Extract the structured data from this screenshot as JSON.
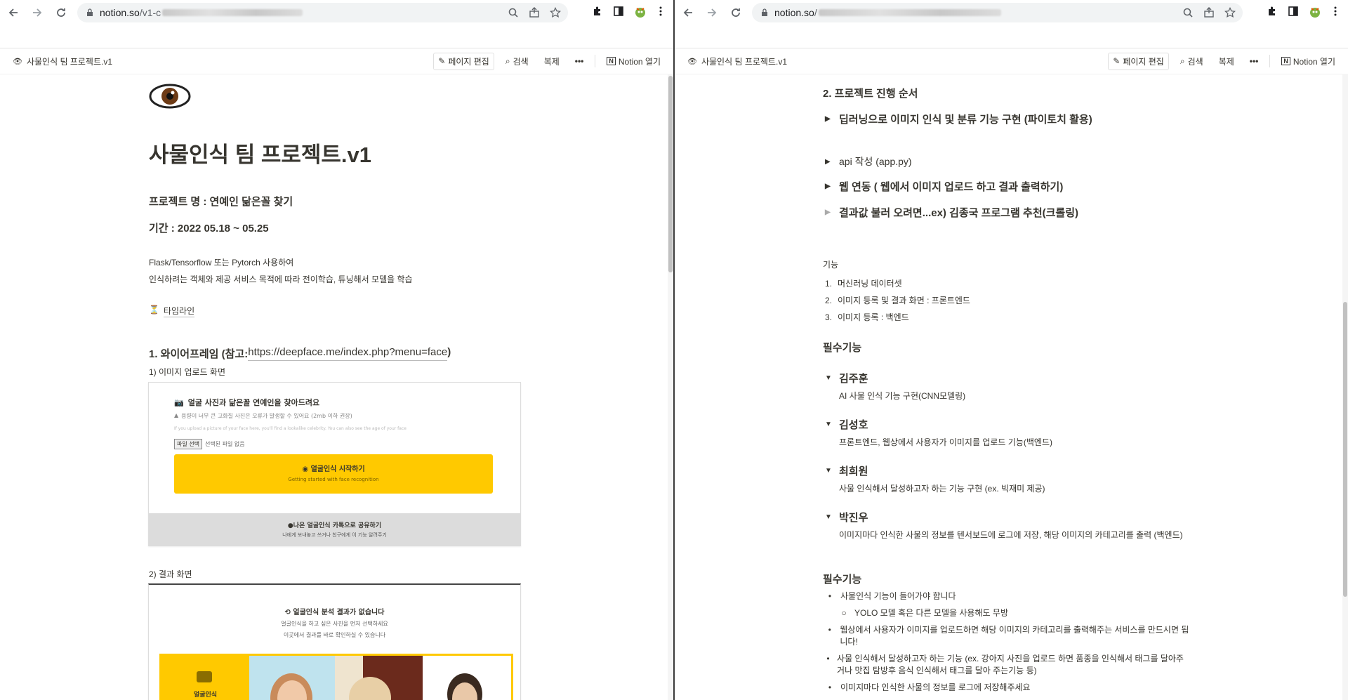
{
  "left": {
    "url_host": "notion.so",
    "url_path": "/v1-c",
    "breadcrumb": "사물인식 팀 프로젝트.v1",
    "actions": {
      "edit": "페이지 편집",
      "search": "검색",
      "duplicate": "복제",
      "open": "Notion 열기"
    },
    "page": {
      "emoji": "👁",
      "title": "사물인식 팀 프로젝트.v1",
      "project_name": "프로젝트 명 : 연예인 닮은꼴 찾기",
      "period": "기간 : 2022 05.18 ~ 05.25",
      "desc1": "Flask/Tensorflow 또는 Pytorch 사용하여",
      "desc2": "인식하려는 객체와 제공 서비스 목적에 따라 전이학습, 튜닝해서 모델을 학습",
      "timeline": "타임라인",
      "section1": "1. 와이어프레임 (참고:",
      "section1_link": "https://deepface.me/index.php?menu=face",
      "section1_close": ")",
      "sub1": "1) 이미지 업로드 화면",
      "upload_title": "얼굴 사진과 닮은꼴 연예인을 찾아드려요",
      "upload_warn": "용량이 너무 큰 고화질 사진은 오류가 발생할 수 있어요 (2mb 이하 권장)",
      "upload_en": "If you upload a picture of your face here, you'll find a lookalike celebrity. You can also see the age of your face",
      "file_btn": "파일 선택",
      "file_none": "선택된 파일 없음",
      "start_btn": "얼굴인식 시작하기",
      "start_sub": "Getting started with face recognition",
      "share_title": "나온 얼굴인식 카톡으로 공유하기",
      "share_sub": "나에게 보내놓고 쓰거나 친구에게 이 기능 알려주기",
      "sub2": "2) 결과 화면",
      "result_title": "얼굴인식 분석 결과가 없습니다",
      "result_sub1": "얼굴인식을 하고 싶은 사진을 먼저 선택하세요",
      "result_sub2": "이곳에서 결과를 바로 확인하실 수 있습니다",
      "result_tile_label": "얼굴인식"
    }
  },
  "right": {
    "url_host": "notion.so",
    "url_path": "/",
    "breadcrumb": "사물인식 팀 프로젝트.v1",
    "actions": {
      "edit": "페이지 편집",
      "search": "검색",
      "duplicate": "복제",
      "open": "Notion 열기"
    },
    "page": {
      "section2": "2. 프로젝트 진행 순서",
      "toggles": [
        "딥러닝으로 이미지 인식 및 분류 기능 구현 (파이토치 활용)",
        "api 작성 (app.py)",
        "웹 연동 ( 웹에서 이미지 업로드 하고 결과 출력하기)",
        "결과값 불러 오려면...ex) 김종국 프로그램 추천(크롤링)"
      ],
      "features_label": "기능",
      "features": [
        "머신러닝 데이터셋",
        "이미지 등록 및 결과 화면 : 프론트엔드",
        "이미지 등록 : 백엔드"
      ],
      "required_heading": "필수기능",
      "members": [
        {
          "name": "김주훈",
          "task": "AI 사물 인식 기능 구현(CNN모델링)"
        },
        {
          "name": "김성호",
          "task": "프론트엔드, 웹상에서 사용자가 이미지를 업로드 기능(백엔드)"
        },
        {
          "name": "최희원",
          "task": "사물 인식해서 달성하고자 하는 기능 구현 (ex. 빅재미 제공)"
        },
        {
          "name": "박진우",
          "task": "이미지마다 인식한 사물의 정보를 텐서보드에 로그에 저장, 해당 이미지의 카테고리를 출력 (백엔드)"
        }
      ],
      "required_heading2": "필수기능",
      "bullets": [
        "사물인식 기능이 들어가야 합니다",
        "웹상에서 사용자가 이미지를 업로드하면 해당 이미지의 카테고리를 출력해주는 서비스를 만드시면 됩니다!",
        "사물 인식해서 달성하고자 하는 기능 (ex. 강아지 사진을 업로드 하면 품종을 인식해서 태그를 달아주거나 맛집 탐방후 음식 인식해서 태그를 달아 주는기능 등)",
        "이미지마다 인식한 사물의 정보를 로그에 저장해주세요"
      ],
      "sub_bullet": "YOLO 모델 혹은 다른 모델을 사용해도 무방"
    }
  }
}
